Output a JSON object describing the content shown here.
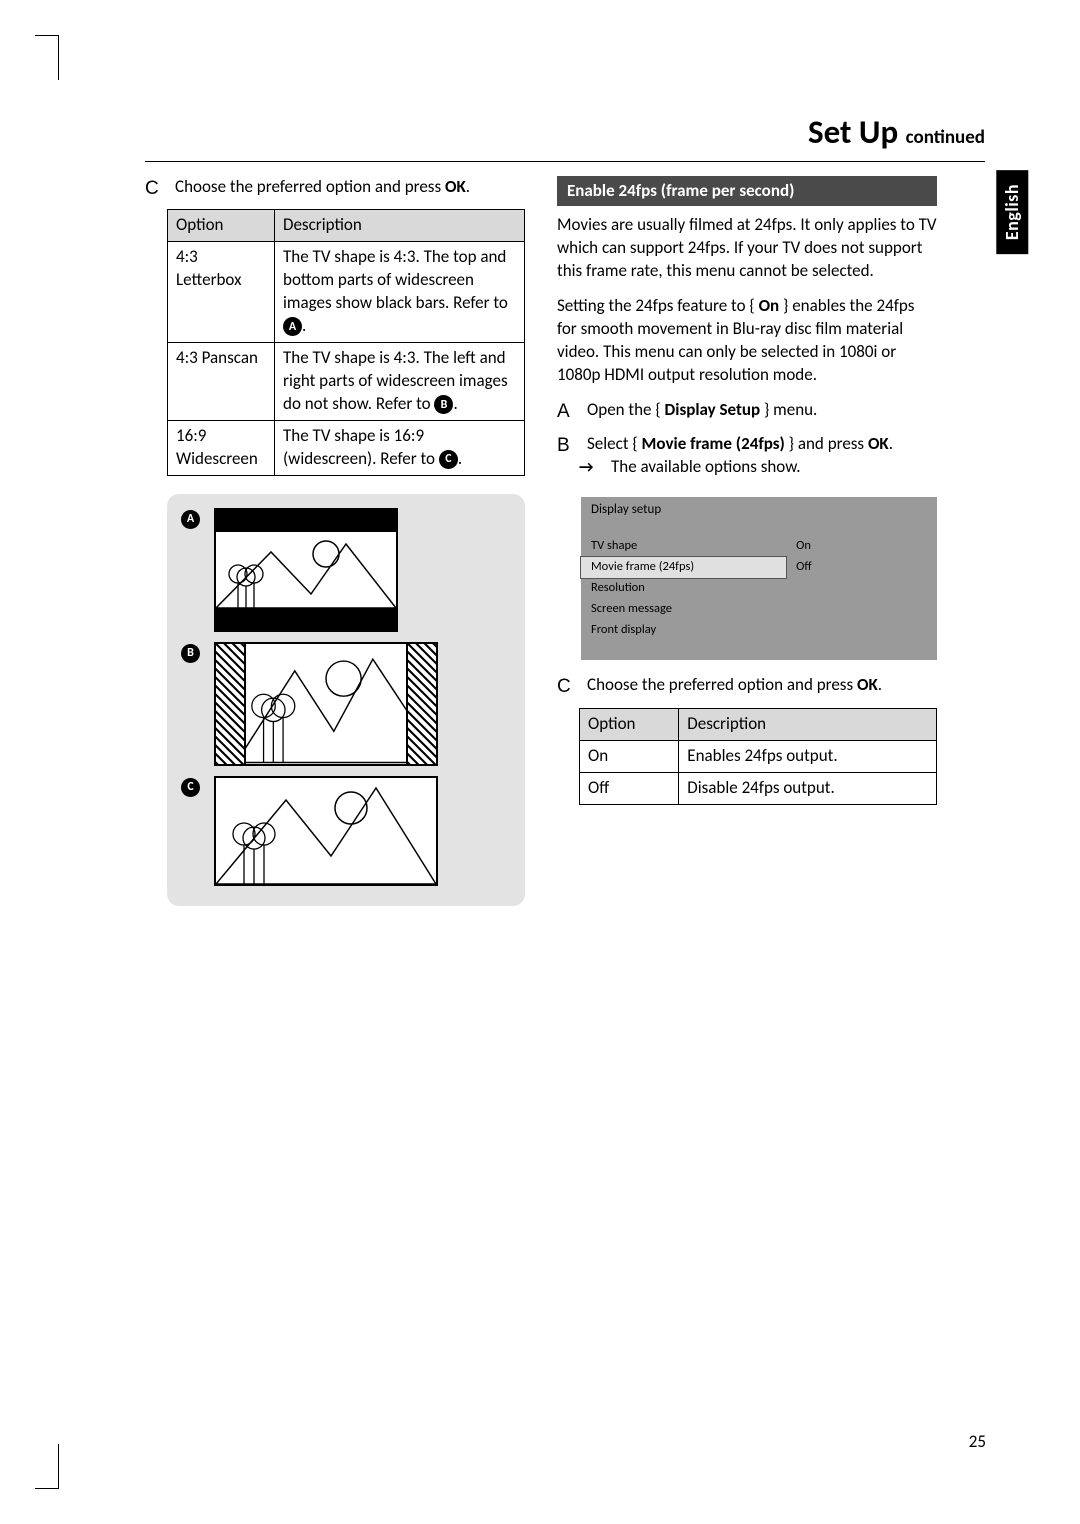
{
  "page": {
    "heading_main": "Set Up",
    "heading_cont": "continued",
    "language_tab": "English",
    "page_number": "25"
  },
  "left": {
    "step_c_letter": "C",
    "step_c_text_a": "Choose the preferred option and press ",
    "step_c_text_b": "OK",
    "step_c_text_c": ".",
    "table_hdr_option": "Option",
    "table_hdr_desc": "Description",
    "row1_opt": "4:3 Letterbox",
    "row1_desc_a": "The TV shape is 4:3. The top and bottom parts of widescreen images show black bars. Refer to ",
    "row1_desc_b": ".",
    "row1_ref": "A",
    "row2_opt": "4:3 Panscan",
    "row2_desc_a": "The TV shape is 4:3. The left and right parts of widescreen images do not show. Refer to ",
    "row2_desc_b": ".",
    "row2_ref": "B",
    "row3_opt": "16:9 Widescreen",
    "row3_desc_a": "The TV shape is 16:9 (widescreen). Refer to ",
    "row3_desc_b": ".",
    "row3_ref": "C",
    "illus_a": "A",
    "illus_b": "B",
    "illus_c": "C"
  },
  "right": {
    "section_header": "Enable 24fps (frame per second)",
    "para1": "Movies are usually filmed at 24fps. It only applies to TV which can support 24fps. If your TV does not support this frame rate, this menu cannot be selected.",
    "para2_a": "Setting the 24fps feature to { ",
    "para2_b": "On",
    "para2_c": " } enables the 24fps for smooth movement in Blu-ray disc film material video. This menu can only be selected in 1080i or 1080p HDMI output resolution mode.",
    "step_a_letter": "A",
    "step_a_a": "Open the { ",
    "step_a_b": "Display Setup",
    "step_a_c": " } menu.",
    "step_b_letter": "B",
    "step_b_a": "Select { ",
    "step_b_b": "Movie frame (24fps)",
    "step_b_c": " } and press ",
    "step_b_d": "OK",
    "step_b_e": ".",
    "step_b_sub_arrow": "→",
    "step_b_sub": "The available options show.",
    "osd": {
      "title": "Display setup",
      "items": [
        "TV shape",
        "Movie frame (24fps)",
        "Resolution",
        "Screen message",
        "Front display"
      ],
      "opts": [
        "On",
        "Off"
      ]
    },
    "step_c_letter": "C",
    "step_c_text_a": "Choose the preferred option and press ",
    "step_c_text_b": "OK",
    "step_c_text_c": ".",
    "tbl2_hdr_option": "Option",
    "tbl2_hdr_desc": "Description",
    "tbl2_row1_opt": "On",
    "tbl2_row1_desc": "Enables 24fps output.",
    "tbl2_row2_opt": "Off",
    "tbl2_row2_desc": "Disable 24fps output."
  }
}
